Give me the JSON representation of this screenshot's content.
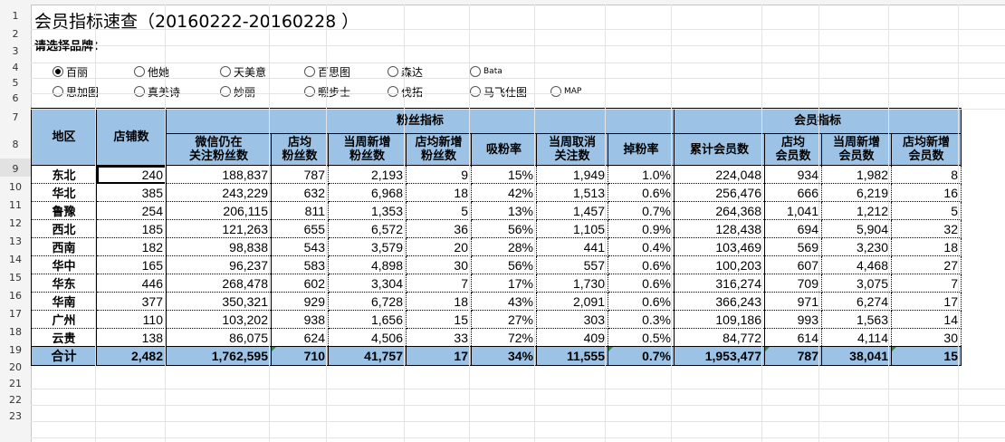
{
  "sheet": {
    "title": "会员指标速查（20160222-20160228 ）",
    "brand_prompt": "请选择品牌：",
    "row_numbers": [
      "1",
      "2",
      "3",
      "4",
      "5",
      "6",
      "7",
      "8",
      "9",
      "10",
      "11",
      "12",
      "13",
      "14",
      "15",
      "16",
      "17",
      "18",
      "19",
      "20",
      "21",
      "22",
      "23"
    ]
  },
  "brands": {
    "selected": "百丽",
    "row1": [
      "百丽",
      "他她",
      "天美意",
      "百思图",
      "森达",
      "Bata"
    ],
    "row2": [
      "思加图",
      "真美诗",
      "妙丽",
      "暇步士",
      "伐拓",
      "马飞仕图",
      "MAP"
    ]
  },
  "table": {
    "group_headers": {
      "region": "地区",
      "stores": "店铺数",
      "fans": "粉丝指标",
      "members": "会员指标"
    },
    "sub_headers": [
      "微信仍在\n关注粉丝数",
      "店均\n粉丝数",
      "当周新增\n粉丝数",
      "店均新增\n粉丝数",
      "吸粉率",
      "当周取消\n关注数",
      "掉粉率",
      "累计会员数",
      "店均\n会员数",
      "当周新增\n会员数",
      "店均新增\n会员数"
    ],
    "rows": [
      [
        "东北",
        "240",
        "188,837",
        "787",
        "2,193",
        "9",
        "15%",
        "1,949",
        "1.0%",
        "224,048",
        "934",
        "1,982",
        "8"
      ],
      [
        "华北",
        "385",
        "243,229",
        "632",
        "6,968",
        "18",
        "42%",
        "1,513",
        "0.6%",
        "256,476",
        "666",
        "6,219",
        "16"
      ],
      [
        "鲁豫",
        "254",
        "206,115",
        "811",
        "1,353",
        "5",
        "13%",
        "1,457",
        "0.7%",
        "264,368",
        "1,041",
        "1,212",
        "5"
      ],
      [
        "西北",
        "185",
        "121,263",
        "655",
        "6,572",
        "36",
        "56%",
        "1,105",
        "0.9%",
        "128,438",
        "694",
        "5,904",
        "32"
      ],
      [
        "西南",
        "182",
        "98,838",
        "543",
        "3,579",
        "20",
        "28%",
        "441",
        "0.4%",
        "103,469",
        "569",
        "3,230",
        "18"
      ],
      [
        "华中",
        "165",
        "96,237",
        "583",
        "4,898",
        "30",
        "56%",
        "557",
        "0.6%",
        "100,203",
        "607",
        "4,468",
        "27"
      ],
      [
        "华东",
        "446",
        "268,478",
        "602",
        "3,304",
        "7",
        "17%",
        "1,730",
        "0.6%",
        "316,274",
        "709",
        "3,075",
        "7"
      ],
      [
        "华南",
        "377",
        "350,321",
        "929",
        "6,728",
        "18",
        "43%",
        "2,091",
        "0.6%",
        "366,243",
        "971",
        "6,274",
        "17"
      ],
      [
        "广州",
        "110",
        "103,202",
        "938",
        "1,656",
        "15",
        "27%",
        "303",
        "0.3%",
        "109,186",
        "993",
        "1,563",
        "14"
      ],
      [
        "云贵",
        "138",
        "86,075",
        "624",
        "4,506",
        "33",
        "72%",
        "409",
        "0.5%",
        "84,772",
        "614",
        "4,114",
        "30"
      ]
    ],
    "total": [
      "合计",
      "2,482",
      "1,762,595",
      "710",
      "41,757",
      "17",
      "34%",
      "11,555",
      "0.7%",
      "1,953,477",
      "787",
      "38,041",
      "15"
    ]
  },
  "colors": {
    "header_fill": "#9cc3e6",
    "grid": "#e4e4e4",
    "error_triangle": "#2e8b3e"
  }
}
